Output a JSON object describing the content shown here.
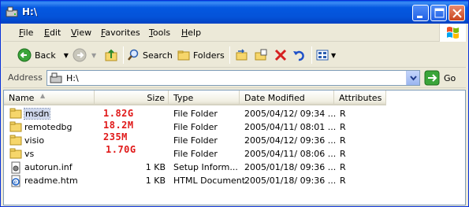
{
  "window": {
    "title": "H:\\"
  },
  "menu": [
    "File",
    "Edit",
    "View",
    "Favorites",
    "Tools",
    "Help"
  ],
  "toolbar": {
    "back": "Back",
    "search": "Search",
    "folders": "Folders"
  },
  "address": {
    "label": "Address",
    "value": "H:\\",
    "go": "Go"
  },
  "columns": {
    "name": "Name",
    "size": "Size",
    "type": "Type",
    "date": "Date Modified",
    "attributes": "Attributes"
  },
  "files": [
    {
      "name": "msdn",
      "size": "",
      "type": "File Folder",
      "date": "2005/04/12/ 09:34 ...",
      "attr": "R",
      "icon": "folder-icon",
      "selected": true
    },
    {
      "name": "remotedbg",
      "size": "",
      "type": "File Folder",
      "date": "2005/04/11/ 08:01 ...",
      "attr": "R",
      "icon": "folder-icon"
    },
    {
      "name": "visio",
      "size": "",
      "type": "File Folder",
      "date": "2005/04/12/ 09:36 ...",
      "attr": "R",
      "icon": "folder-icon"
    },
    {
      "name": "vs",
      "size": "",
      "type": "File Folder",
      "date": "2005/04/11/ 08:06 ...",
      "attr": "R",
      "icon": "folder-icon"
    },
    {
      "name": "autorun.inf",
      "size": "1 KB",
      "type": "Setup Inform...",
      "date": "2005/01/18/ 09:36 ...",
      "attr": "R",
      "icon": "settings-file-icon"
    },
    {
      "name": "readme.htm",
      "size": "1 KB",
      "type": "HTML Document",
      "date": "2005/01/18/ 09:36 ...",
      "attr": "R",
      "icon": "html-file-icon"
    }
  ],
  "annotations": [
    "1.82G",
    "18.2M",
    "235M",
    "1.70G"
  ],
  "colors": {
    "titlebar": "#0458e0",
    "annotation": "#e01818",
    "selection": "#cfd8ec"
  }
}
